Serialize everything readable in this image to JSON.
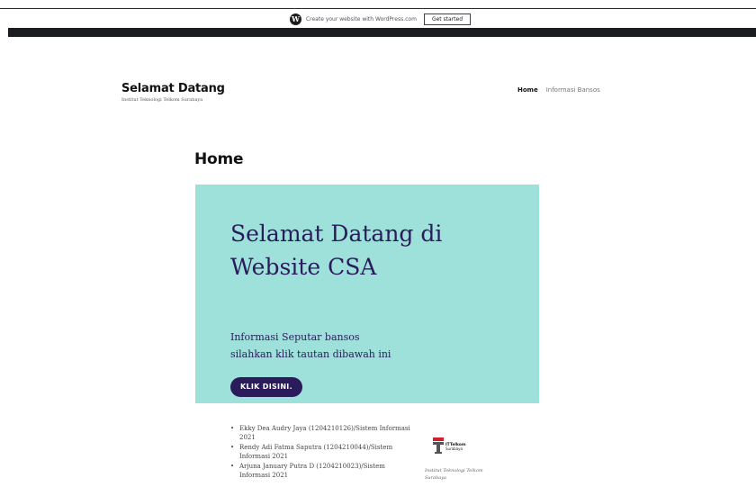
{
  "wp_bar": {
    "logo_glyph": "W",
    "text": "Create your website with WordPress.com",
    "button_label": "Get started"
  },
  "header": {
    "site_title": "Selamat Datang",
    "site_description": "Institut Teknologi Telkom Surabaya",
    "nav": [
      {
        "label": "Home",
        "active": true
      },
      {
        "label": "Informasi Bansos",
        "active": false
      }
    ]
  },
  "page": {
    "title": "Home"
  },
  "cover": {
    "background": "#9ee0da",
    "text_color": "#2a1b5a",
    "heading": "Selamat Datang di Website CSA",
    "line1": "Informasi Seputar bansos",
    "line2": "silahkan klik tautan dibawah ini",
    "button_label": "KLIK DISINI."
  },
  "team": [
    "Ekky Dea Audry Jaya (1204210126)/Sistem Informasi 2021",
    "Rendy Adi Fatma Saputra (1204210044)/Sistem Informasi 2021",
    "Arjuna January Putra D (1204210023)/Sistem Informasi 2021"
  ],
  "logo": {
    "icon": "ittelkom-logo-icon",
    "text_top": "ITTelkom",
    "text_bottom": "Surabaya",
    "caption": "Institut Teknologi Telkom Surabaya"
  }
}
